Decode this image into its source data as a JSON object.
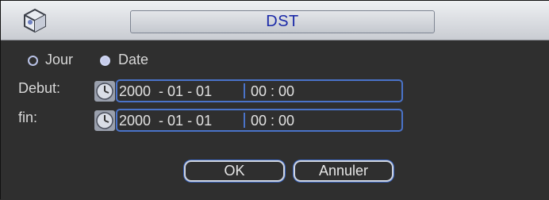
{
  "window": {
    "title": "DST"
  },
  "mode": {
    "options": [
      {
        "label": "Jour",
        "selected": false
      },
      {
        "label": "Date",
        "selected": true
      }
    ]
  },
  "start": {
    "label": "Debut:",
    "date": "2000  - 01 - 01",
    "time": "00 : 00"
  },
  "end": {
    "label": "fin:",
    "date": "2000  - 01 - 01",
    "time": "00 : 00"
  },
  "buttons": {
    "ok": "OK",
    "cancel": "Annuler"
  },
  "colors": {
    "title_text": "#1b2aa8",
    "field_border": "#4a73c9",
    "background": "#2f2f2f"
  },
  "icons": {
    "window": "cube-icon",
    "clock": "clock-icon"
  }
}
